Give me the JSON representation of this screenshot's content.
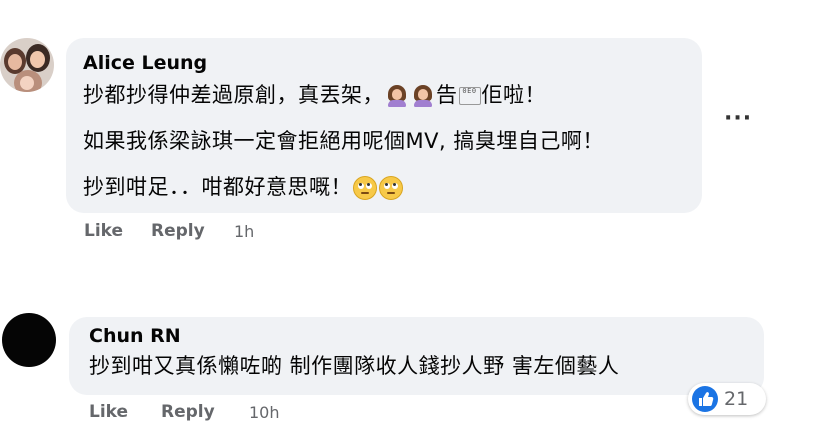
{
  "comments": [
    {
      "author": "Alice Leung",
      "lines": [
        {
          "before": "抄都抄得仲差過原創，真丟架，",
          "missing_glyph": "0E0",
          "after": "佢啦！"
        },
        {
          "text": "如果我係梁詠琪一定會拒絕用呢個MV, 搞臭埋自己啊！"
        },
        {
          "text": "抄到咁足．．咁都好意思嘅！"
        }
      ],
      "actions": {
        "like": "Like",
        "reply": "Reply"
      },
      "time": "1h",
      "more_label": "···",
      "emojis": [
        "woman-facepalming-icon",
        "woman-facepalming-icon",
        "eye-roll-face-icon",
        "eye-roll-face-icon"
      ]
    },
    {
      "author": "Chun RN",
      "text": "抄到咁又真係懶咗啲 制作團隊收人錢抄人野 害左個藝人",
      "actions": {
        "like": "Like",
        "reply": "Reply"
      },
      "time": "10h",
      "reactions": {
        "icon": "thumbs-up-icon",
        "count": "21"
      }
    }
  ],
  "colors": {
    "bubble": "#f0f2f5",
    "secondary_text": "#65676b",
    "like_blue": "#1b74e4"
  }
}
